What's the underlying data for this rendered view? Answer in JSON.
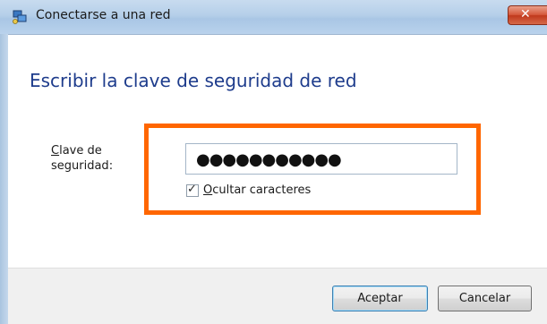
{
  "window": {
    "title": "Conectarse a una red",
    "close_label": "✕"
  },
  "main": {
    "heading": "Escribir la clave de seguridad de red",
    "security_key": {
      "label_line1_accel": "C",
      "label_line1_rest": "lave de",
      "label_line2": "seguridad:",
      "masked_value": "●●●●●●●●●●●"
    },
    "hide_characters": {
      "checked": true,
      "check_mark": "✓",
      "label_accel": "O",
      "label_rest": "cultar caracteres"
    }
  },
  "footer": {
    "ok_label": "Aceptar",
    "cancel_label": "Cancelar"
  },
  "colors": {
    "highlight": "#ff6600",
    "heading": "#1e3c8c"
  },
  "icons": {
    "title": "network-icon",
    "close": "close-icon"
  }
}
